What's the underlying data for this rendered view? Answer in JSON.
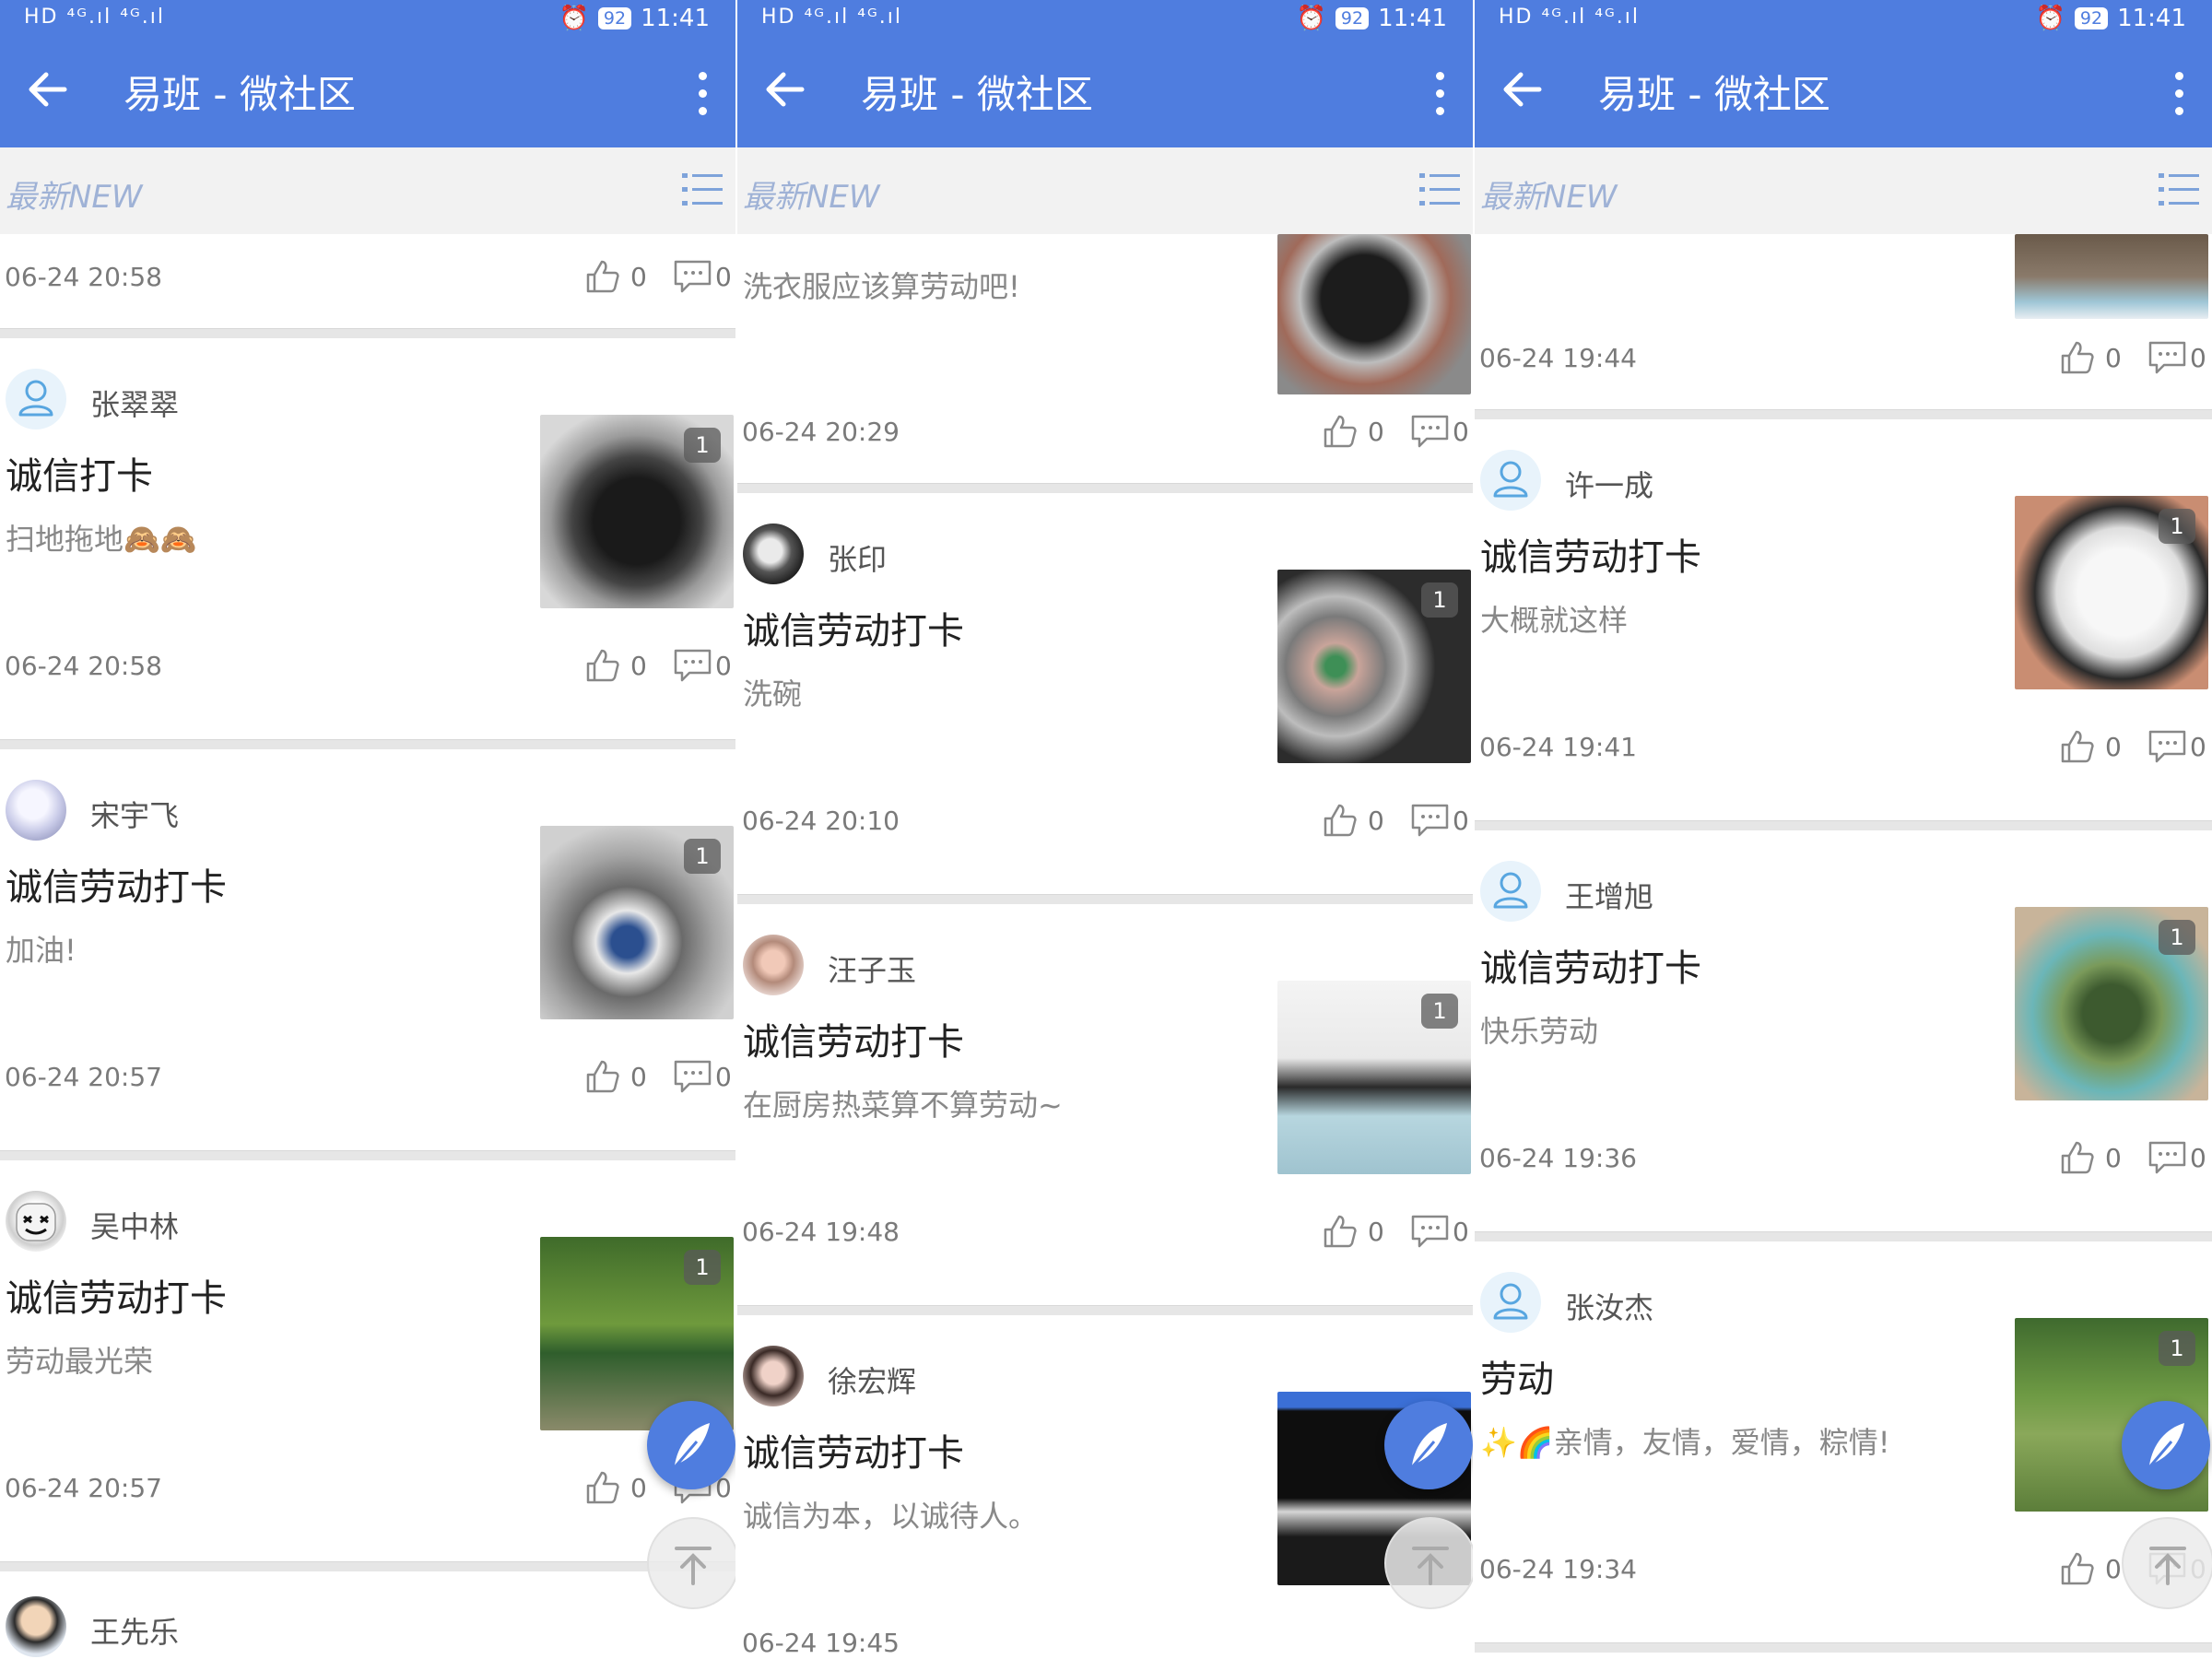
{
  "statusbar": {
    "left": "HD ⁴ᴳ.ıl ⁴ᴳ.ıl",
    "battery": "92",
    "time": "11:41"
  },
  "app": {
    "title": "易班 - 微社区",
    "tab": "最新NEW"
  },
  "colors": {
    "primary": "#4f7ddf",
    "tab_text": "#9fb2d6"
  },
  "screens": [
    {
      "posts": [
        {
          "user": "",
          "title": "",
          "desc": "",
          "date": "06-24 20:58",
          "likes": "0",
          "comments": "0",
          "img_count": ""
        },
        {
          "user": "张翠翠",
          "title": "诚信打卡",
          "desc": "扫地拖地🙈🙈",
          "date": "06-24 20:58",
          "likes": "0",
          "comments": "0",
          "img_count": "1"
        },
        {
          "user": "宋宇飞",
          "title": "诚信劳动打卡",
          "desc": "加油!",
          "date": "06-24 20:57",
          "likes": "0",
          "comments": "0",
          "img_count": "1"
        },
        {
          "user": "吴中林",
          "title": "诚信劳动打卡",
          "desc": "劳动最光荣",
          "date": "06-24 20:57",
          "likes": "0",
          "comments": "0",
          "img_count": "1"
        },
        {
          "user": "王先乐"
        }
      ]
    },
    {
      "posts": [
        {
          "desc": "洗衣服应该算劳动吧!",
          "date": "06-24 20:29",
          "likes": "0",
          "comments": "0"
        },
        {
          "user": "张印",
          "title": "诚信劳动打卡",
          "desc": "洗碗",
          "date": "06-24 20:10",
          "likes": "0",
          "comments": "0",
          "img_count": "1"
        },
        {
          "user": "汪子玉",
          "title": "诚信劳动打卡",
          "desc": "在厨房热菜算不算劳动~",
          "date": "06-24 19:48",
          "likes": "0",
          "comments": "0",
          "img_count": "1"
        },
        {
          "user": "徐宏辉",
          "title": "诚信劳动打卡",
          "desc": "诚信为本，以诚待人。",
          "date": "06-24 19:45"
        }
      ]
    },
    {
      "posts": [
        {
          "date": "06-24 19:44",
          "likes": "0",
          "comments": "0"
        },
        {
          "user": "许一成",
          "title": "诚信劳动打卡",
          "desc": "大概就这样",
          "date": "06-24 19:41",
          "likes": "0",
          "comments": "0",
          "img_count": "1"
        },
        {
          "user": "王增旭",
          "title": "诚信劳动打卡",
          "desc": "快乐劳动",
          "date": "06-24 19:36",
          "likes": "0",
          "comments": "0",
          "img_count": "1"
        },
        {
          "user": "张汝杰",
          "title": "劳动",
          "desc": "✨🌈亲情，友情，爱情，粽情!",
          "date": "06-24 19:34",
          "likes": "0",
          "comments": "0",
          "img_count": "1"
        }
      ]
    }
  ]
}
